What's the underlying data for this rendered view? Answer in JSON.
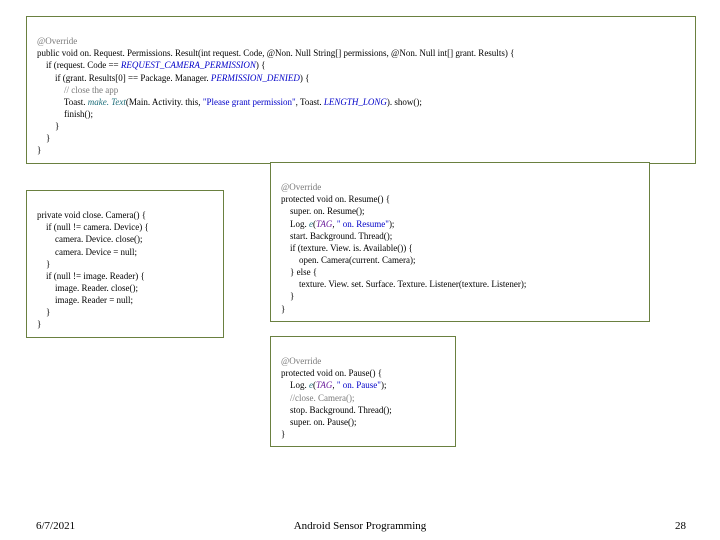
{
  "box1": {
    "l1": {
      "a": "@Override"
    },
    "l2": {
      "a": "public void ",
      "b": "on. Request. Permissions. Result",
      "c": "(int request. Code, @Non. Null String[] permissions, @Non. Null int[] grant. Results) {"
    },
    "l3": {
      "a": "    if (request. Code == ",
      "b": "REQUEST_CAMERA_PERMISSION",
      "c": ") {"
    },
    "l4": {
      "a": "        if (grant. Results[0] == Package. Manager. ",
      "b": "PERMISSION_DENIED",
      "c": ") {"
    },
    "l5": {
      "a": "            // close the app"
    },
    "l6": {
      "a": "            Toast. ",
      "b": "make. Text",
      "c": "(Main. Activity. this, ",
      "d": "\"Please grant permission\"",
      "e": ", Toast. ",
      "f": "LENGTH_LONG",
      "g": "). show();"
    },
    "l7": {
      "a": "            finish();"
    },
    "l8": {
      "a": "        }"
    },
    "l9": {
      "a": "    }"
    },
    "l10": {
      "a": "}"
    }
  },
  "box2": {
    "l1": {
      "a": "private void ",
      "b": "close. Camera",
      "c": "() {"
    },
    "l2": {
      "a": "    if (null != camera. Device) {"
    },
    "l3": {
      "a": "        camera. Device. close();"
    },
    "l4": {
      "a": "        camera. Device = null;"
    },
    "l5": {
      "a": "    }"
    },
    "l6": {
      "a": "    if (null != image. Reader) {"
    },
    "l7": {
      "a": "        image. Reader. close();"
    },
    "l8": {
      "a": "        image. Reader = null;"
    },
    "l9": {
      "a": "    }"
    },
    "l10": {
      "a": "}"
    }
  },
  "box3": {
    "l1": {
      "a": "@Override"
    },
    "l2": {
      "a": "protected void ",
      "b": "on. Resume",
      "c": "() {"
    },
    "l3": {
      "a": "    super. on. Resume();"
    },
    "l4": {
      "a": "    Log. ",
      "b": "e",
      "c": "(",
      "d": "TAG",
      "e": ", ",
      "f": "\" on. Resume\"",
      "g": ");"
    },
    "l5": {
      "a": "    start. Background. Thread();"
    },
    "l6": {
      "a": "    if (texture. View. is. Available()) {"
    },
    "l7": {
      "a": "        open. Camera(current. Camera);"
    },
    "l8": {
      "a": "    } else {"
    },
    "l9": {
      "a": "        texture. View. set. Surface. Texture. Listener(texture. Listener);"
    },
    "l10": {
      "a": "    }"
    },
    "l11": {
      "a": "}"
    }
  },
  "box4": {
    "l1": {
      "a": "@Override"
    },
    "l2": {
      "a": "protected void ",
      "b": "on. Pause",
      "c": "() {"
    },
    "l3": {
      "a": "    Log. ",
      "b": "e",
      "c": "(",
      "d": "TAG",
      "e": ", ",
      "f": "\" on. Pause\"",
      "g": ");"
    },
    "l4": {
      "a": "    //close. Camera();"
    },
    "l5": {
      "a": "    stop. Background. Thread();"
    },
    "l6": {
      "a": "    super. on. Pause();"
    },
    "l7": {
      "a": "}"
    }
  },
  "footer": {
    "date": "6/7/2021",
    "title": "Android Sensor Programming",
    "page": "28"
  }
}
